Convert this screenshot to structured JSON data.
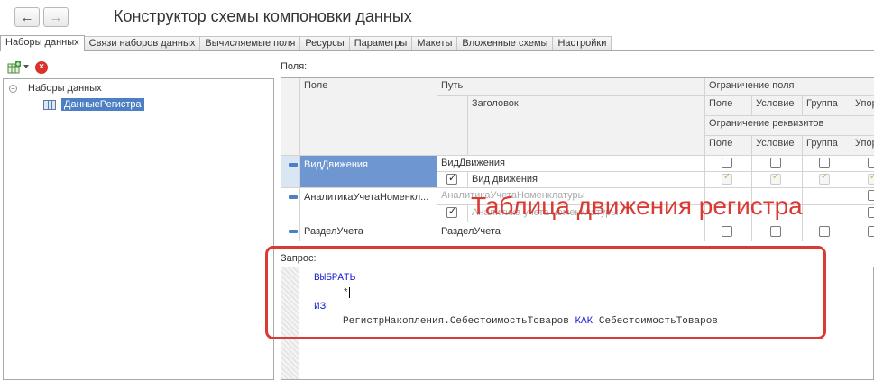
{
  "window": {
    "title": "Конструктор схемы компоновки данных",
    "back_icon": "←",
    "forward_icon": "→"
  },
  "tabs": [
    {
      "label": "Наборы данных",
      "active": true
    },
    {
      "label": "Связи наборов данных"
    },
    {
      "label": "Вычисляемые поля"
    },
    {
      "label": "Ресурсы"
    },
    {
      "label": "Параметры"
    },
    {
      "label": "Макеты"
    },
    {
      "label": "Вложенные схемы"
    },
    {
      "label": "Настройки"
    }
  ],
  "left": {
    "toolbar": {
      "add_icon": "table-add-icon",
      "delete_icon": "×"
    },
    "tree": {
      "root_toggle": "−",
      "root": "Наборы данных",
      "child": "ДанныеРегистра"
    }
  },
  "fields": {
    "label": "Поля:",
    "headers": {
      "field": "Поле",
      "path": "Путь",
      "caption": "Заголовок",
      "field_restriction": "Ограничение поля",
      "attr_restriction": "Ограничение реквизитов",
      "sub": [
        "Поле",
        "Условие",
        "Группа",
        "Упор"
      ]
    },
    "rows": [
      {
        "field": "ВидДвижения",
        "path": "ВидДвижения",
        "caption": "Вид движения"
      },
      {
        "field": "АналитикаУчетаНоменкл...",
        "path": "АналитикаУчетаНоменклатуры",
        "caption": "Аналитика учета номенклатуры"
      },
      {
        "field": "РазделУчета",
        "path": "РазделУчета"
      }
    ]
  },
  "annotation": "Таблица движения регистра",
  "query": {
    "label": "Запрос:",
    "lines": {
      "select": "ВЫБРАТЬ",
      "star": "*",
      "from": "ИЗ",
      "source": "РегистрНакопления.СебестоимостьТоваров",
      "as": "КАК",
      "alias": "СебестоимостьТоваров"
    }
  },
  "colors": {
    "selection": "#6e97d2",
    "annotation": "#d93a33",
    "keyword": "#1b1bd4"
  }
}
